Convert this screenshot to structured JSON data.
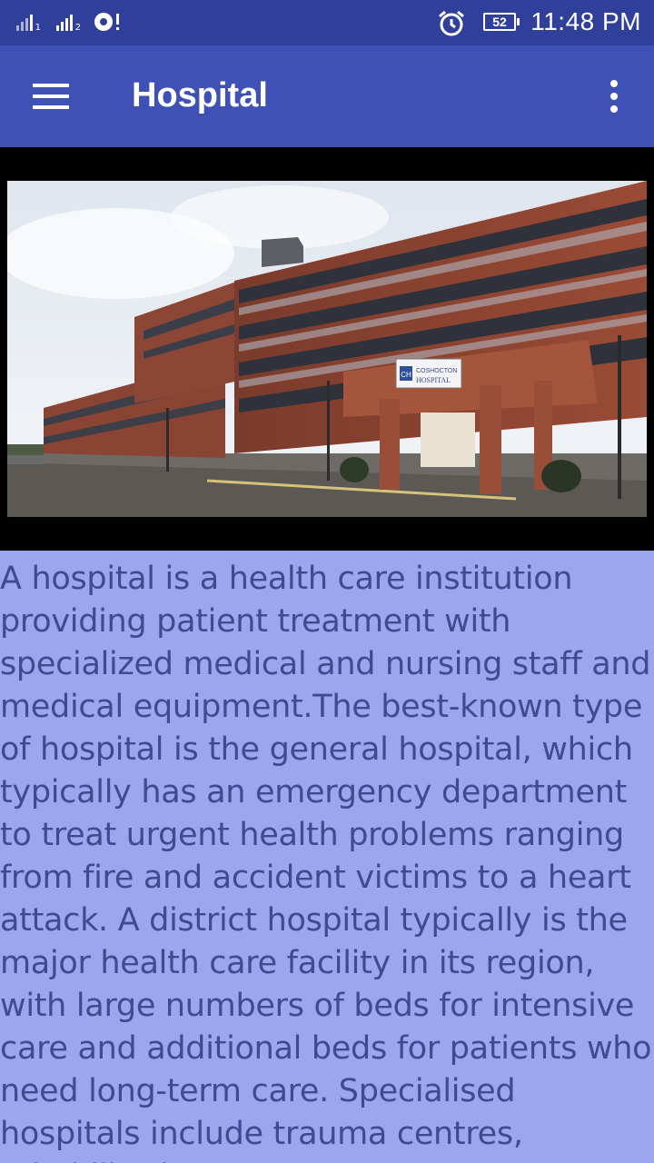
{
  "status_bar": {
    "time": "11:48 PM",
    "battery": "52",
    "sim1_label": "1",
    "sim2_label": "2",
    "icons": [
      "signal-sim1-icon",
      "signal-sim2-icon",
      "data-sync-icon",
      "alarm-icon",
      "battery-icon"
    ]
  },
  "app_bar": {
    "title": "Hospital",
    "menu_icon": "hamburger-menu-icon",
    "overflow_icon": "more-vert-icon"
  },
  "hero_image": {
    "sign_line1": "COSHOCTON",
    "sign_line2": "HOSPITAL",
    "sign_logo": "CH"
  },
  "content": {
    "text": "A hospital is a health care institution providing patient treatment with specialized medical and nursing staff and medical equipment.The best-known type of hospital is the general hospital, which typically has an emergency department to treat urgent health problems ranging from fire and accident victims to a heart attack. A district hospital typically is the major health care facility in its region, with large numbers of beds for intensive care and additional beds for patients who need long-term care. Specialised hospitals include trauma centres, rehabilitation"
  },
  "colors": {
    "status_bar": "#2f3f9a",
    "app_bar": "#3f51b5",
    "content_bg": "#9aa6ed",
    "content_text": "#404a8c"
  }
}
